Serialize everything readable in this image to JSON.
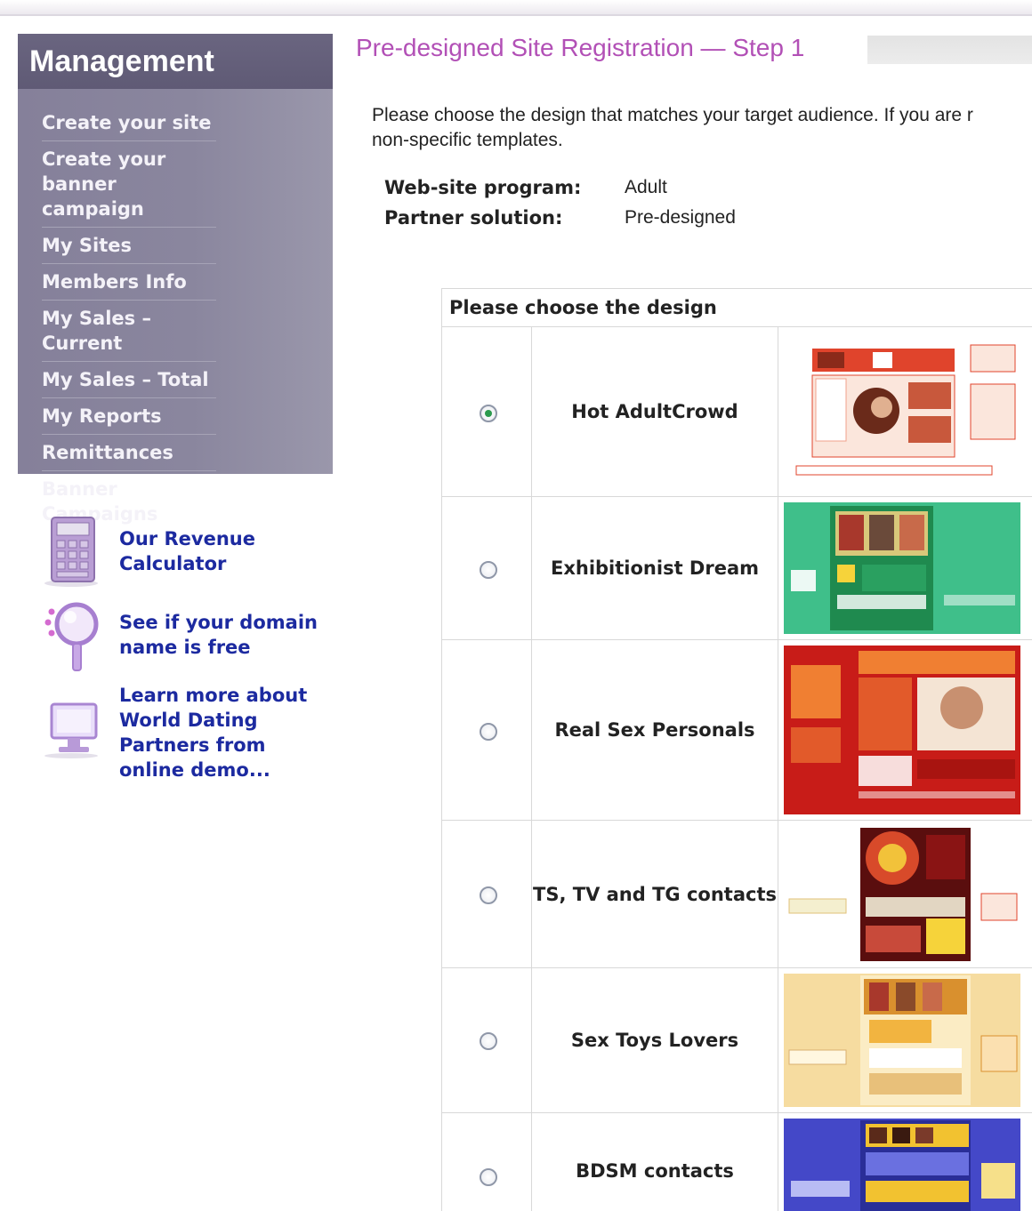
{
  "sidebar": {
    "title": "Management",
    "items": [
      {
        "label": "Create your site"
      },
      {
        "label": "Create your banner campaign"
      },
      {
        "label": "My Sites"
      },
      {
        "label": "Members Info"
      },
      {
        "label": "My Sales – Current"
      },
      {
        "label": "My Sales – Total"
      },
      {
        "label": "My Reports"
      },
      {
        "label": "Remittances"
      },
      {
        "label": "Banner Campaigns"
      }
    ],
    "tools": [
      {
        "label": "Our Revenue Calculator",
        "icon": "calculator-icon"
      },
      {
        "label": "See if your domain name is free",
        "icon": "magnifier-icon"
      },
      {
        "label": "Learn more about World Dating Partners from online demo...",
        "icon": "monitor-icon"
      }
    ]
  },
  "main": {
    "title": "Pre-designed Site Registration — Step 1",
    "intro_line1": "Please choose the design that matches your target audience. If you are r",
    "intro_line2": "non-specific templates.",
    "info": [
      {
        "label": "Web-site program:",
        "value": "Adult"
      },
      {
        "label": "Partner solution:",
        "value": "Pre-designed"
      }
    ],
    "designs_heading": "Please choose the design",
    "designs": [
      {
        "name": "Hot AdultCrowd",
        "selected": true,
        "accent": "#e0442c",
        "bg": "#ffffff"
      },
      {
        "name": "Exhibitionist Dream",
        "selected": false,
        "accent": "#1f8a4f",
        "bg": "#3fbf8a"
      },
      {
        "name": "Real Sex Personals",
        "selected": false,
        "accent": "#f07f32",
        "bg": "#c81c18"
      },
      {
        "name": "TS, TV and TG contacts",
        "selected": false,
        "accent": "#8a1414",
        "bg": "#ffffff"
      },
      {
        "name": "Sex Toys Lovers",
        "selected": false,
        "accent": "#d9902e",
        "bg": "#f6dca0"
      },
      {
        "name": "BDSM contacts",
        "selected": false,
        "accent": "#f2c230",
        "bg": "#4448c8"
      }
    ]
  }
}
